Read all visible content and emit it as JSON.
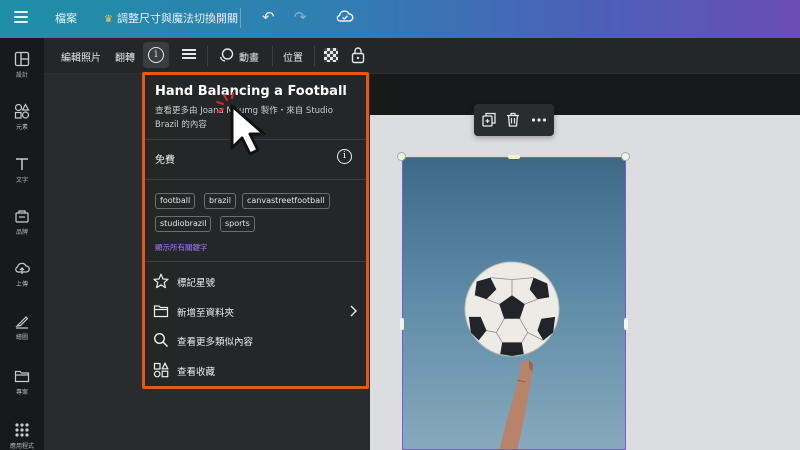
{
  "topbar": {
    "file_label": "檔案",
    "resize_label": "調整尺寸與魔法切換開關",
    "icons": [
      "menu-icon",
      "crown-icon",
      "undo-icon",
      "redo-icon",
      "cloud-icon"
    ]
  },
  "sidebar": {
    "items": [
      {
        "label": "設計",
        "icon": "layout-icon"
      },
      {
        "label": "元素",
        "icon": "shapes-icon"
      },
      {
        "label": "文字",
        "icon": "text-icon"
      },
      {
        "label": "品牌",
        "icon": "brand-icon"
      },
      {
        "label": "上傳",
        "icon": "upload-icon"
      },
      {
        "label": "繪圖",
        "icon": "draw-icon"
      },
      {
        "label": "專案",
        "icon": "folder-icon"
      },
      {
        "label": "應用程式",
        "icon": "apps-icon"
      }
    ]
  },
  "ctxbar": {
    "edit_photo": "編輯照片",
    "flip": "翻轉",
    "animate": "動畫",
    "position": "位置"
  },
  "popover": {
    "title": "Hand Balancing a Football",
    "subtitle": "查看更多由 Joana Maumg 製作・來自 Studio Brazil 的內容",
    "free": "免費",
    "tags": [
      "football",
      "brazil",
      "canvastreetfootball",
      "studiobrazil",
      "sports"
    ],
    "show_all": "顯示所有關鍵字",
    "actions": [
      {
        "label": "標記星號",
        "icon": "star-icon"
      },
      {
        "label": "新增至資料夾",
        "icon": "folder-icon"
      },
      {
        "label": "查看更多類似內容",
        "icon": "search-icon"
      },
      {
        "label": "查看收藏",
        "icon": "collection-icon"
      }
    ]
  },
  "colors": {
    "popover_border": "#e05a1c",
    "accent_purple": "#a07cf3",
    "topbar_gradient_start": "#1f8fa6",
    "topbar_gradient_end": "#6a4db5"
  }
}
